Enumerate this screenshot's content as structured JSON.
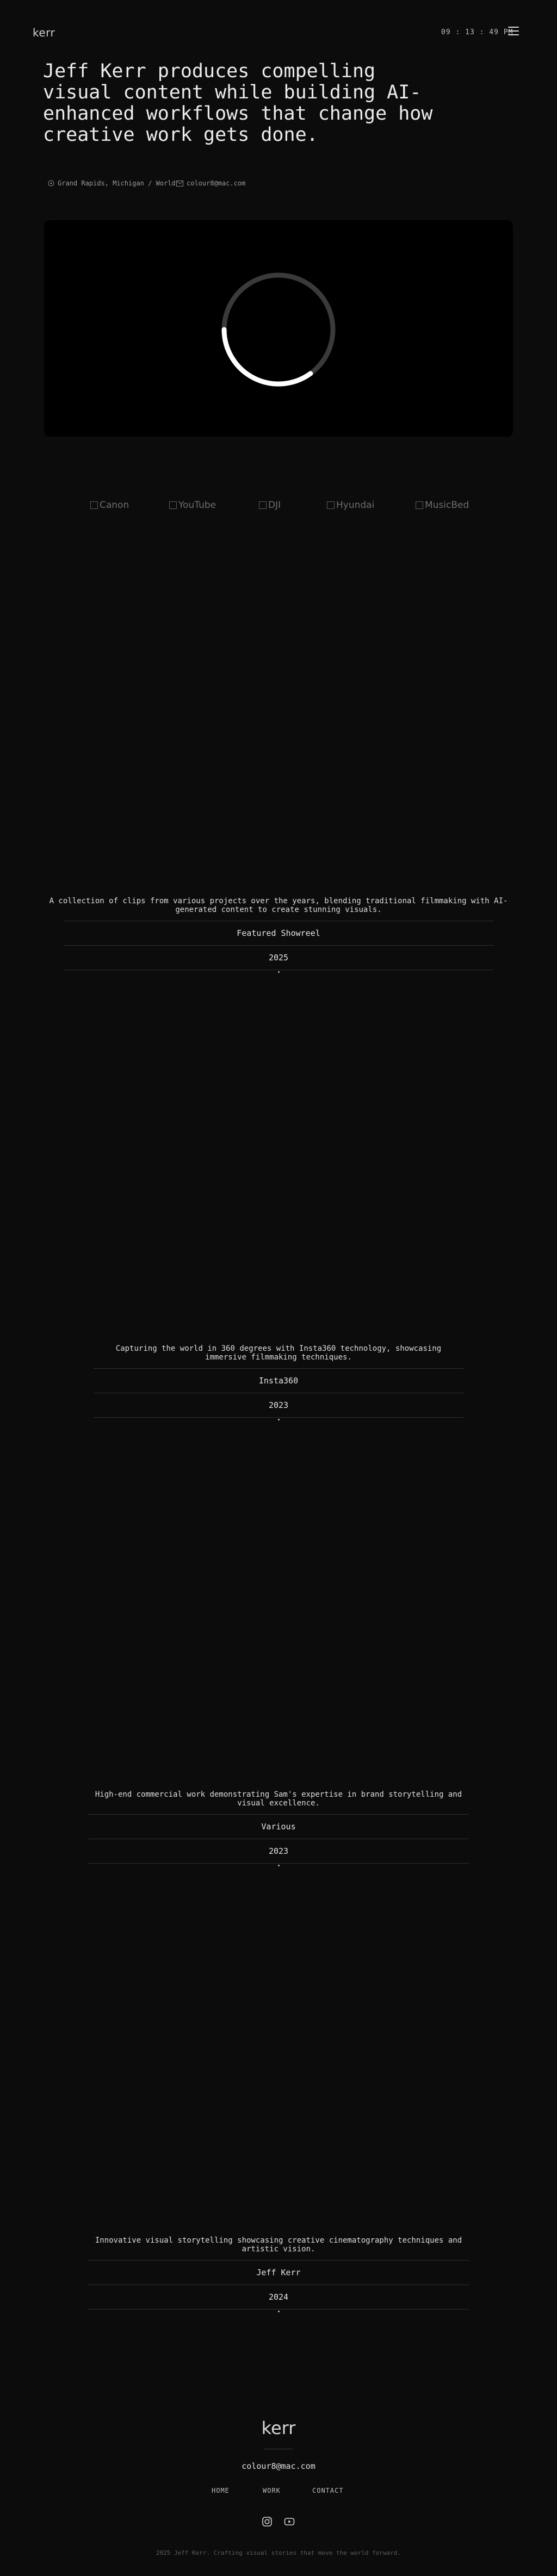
{
  "header": {
    "logo": "kerr",
    "time": "09 : 13 : 49 PM"
  },
  "hero": {
    "title": "Jeff Kerr produces compelling visual content while building AI-enhanced workflows that change how creative work gets done.",
    "location": "Grand Rapids, Michigan / World",
    "email": "colour8@mac.com"
  },
  "brands": [
    {
      "name": "Canon"
    },
    {
      "name": "YouTube"
    },
    {
      "name": "DJI"
    },
    {
      "name": "Hyundai"
    },
    {
      "name": "MusicBed"
    }
  ],
  "projects": [
    {
      "description": "A collection of clips from various projects over the years, blending traditional filmmaking with AI-generated content to create stunning visuals.",
      "client": "Featured Showreel",
      "year": "2025"
    },
    {
      "description": "Capturing the world in 360 degrees with Insta360 technology, showcasing immersive filmmaking techniques.",
      "client": "Insta360",
      "year": "2023"
    },
    {
      "description": "High-end commercial work demonstrating Sam's expertise in brand storytelling and visual excellence.",
      "client": "Various",
      "year": "2023"
    },
    {
      "description": "Innovative visual storytelling showcasing creative cinematography techniques and artistic vision.",
      "client": "Jeff Kerr",
      "year": "2024"
    }
  ],
  "footer": {
    "logo": "kerr",
    "email": "colour8@mac.com",
    "nav": [
      "HOME",
      "WORK",
      "CONTACT"
    ],
    "social_icons": [
      "instagram-icon",
      "youtube-icon"
    ],
    "copyright": "2025 Jeff Kerr. Crafting visual stories that move the world forward."
  },
  "colors": {
    "background": "#0c0c0c",
    "text": "#e6e6e6",
    "muted": "#9a9a9a",
    "spinner": "#ffffff"
  }
}
